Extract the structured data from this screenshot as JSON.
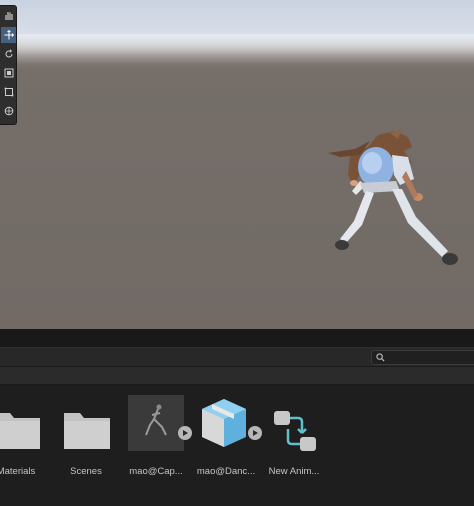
{
  "scene_view": {
    "tools": [
      {
        "name": "hand-tool-icon",
        "glyph": "✋",
        "active": false
      },
      {
        "name": "move-tool-icon",
        "glyph": "✥",
        "active": true
      },
      {
        "name": "rotate-tool-icon",
        "glyph": "↻",
        "active": false
      },
      {
        "name": "scale-tool-icon",
        "glyph": "▣",
        "active": false
      },
      {
        "name": "rect-tool-icon",
        "glyph": "⬚",
        "active": false
      },
      {
        "name": "transform-tool-icon",
        "glyph": "⊛",
        "active": false
      }
    ]
  },
  "project": {
    "search": {
      "placeholder": "",
      "value": ""
    },
    "assets": [
      {
        "label": "Materials",
        "type": "folder"
      },
      {
        "label": "Scenes",
        "type": "folder"
      },
      {
        "label": "mao@Cap...",
        "type": "model-preview"
      },
      {
        "label": "mao@Danc...",
        "type": "prefab"
      },
      {
        "label": "New Anim...",
        "type": "animator-controller"
      }
    ]
  },
  "colors": {
    "accent": "#46607f",
    "prefab_blue": "#5fb0dc",
    "animator_teal": "#5fc0c8"
  }
}
